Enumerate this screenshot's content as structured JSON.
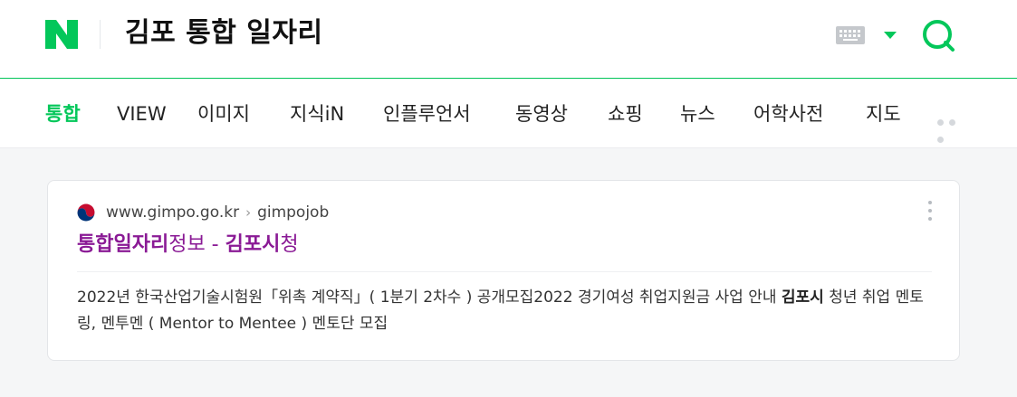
{
  "header": {
    "logo_letter": "N",
    "query": "김포 통합 일자리",
    "keyboard_icon": "keyboard-icon",
    "dropdown_icon": "triangle-down-icon",
    "search_icon": "search-icon",
    "brand_color": "#03c75a"
  },
  "tabs": [
    {
      "label": "통합",
      "active": true
    },
    {
      "label": "VIEW",
      "active": false
    },
    {
      "label": "이미지",
      "active": false
    },
    {
      "label": "지식iN",
      "active": false
    },
    {
      "label": "인플루언서",
      "active": false
    },
    {
      "label": "동영상",
      "active": false
    },
    {
      "label": "쇼핑",
      "active": false
    },
    {
      "label": "뉴스",
      "active": false
    },
    {
      "label": "어학사전",
      "active": false
    },
    {
      "label": "지도",
      "active": false
    }
  ],
  "result": {
    "domain": "www.gimpo.go.kr",
    "separator": "›",
    "path": "gimpojob",
    "title_parts": [
      "통합일자리",
      "정보 - ",
      "김포시",
      "청"
    ],
    "description_parts": [
      "2022년 한국산업기술시험원「위촉 계약직」( 1분기 2차수 ) 공개모집2022 경기여성 취업지원금 사업 안내 ",
      "김포시",
      " 청년 취업 멘토링, 멘투멘 ( Mentor to Mentee ) 멘토단 모집"
    ],
    "title_color": "#8a1a95"
  }
}
